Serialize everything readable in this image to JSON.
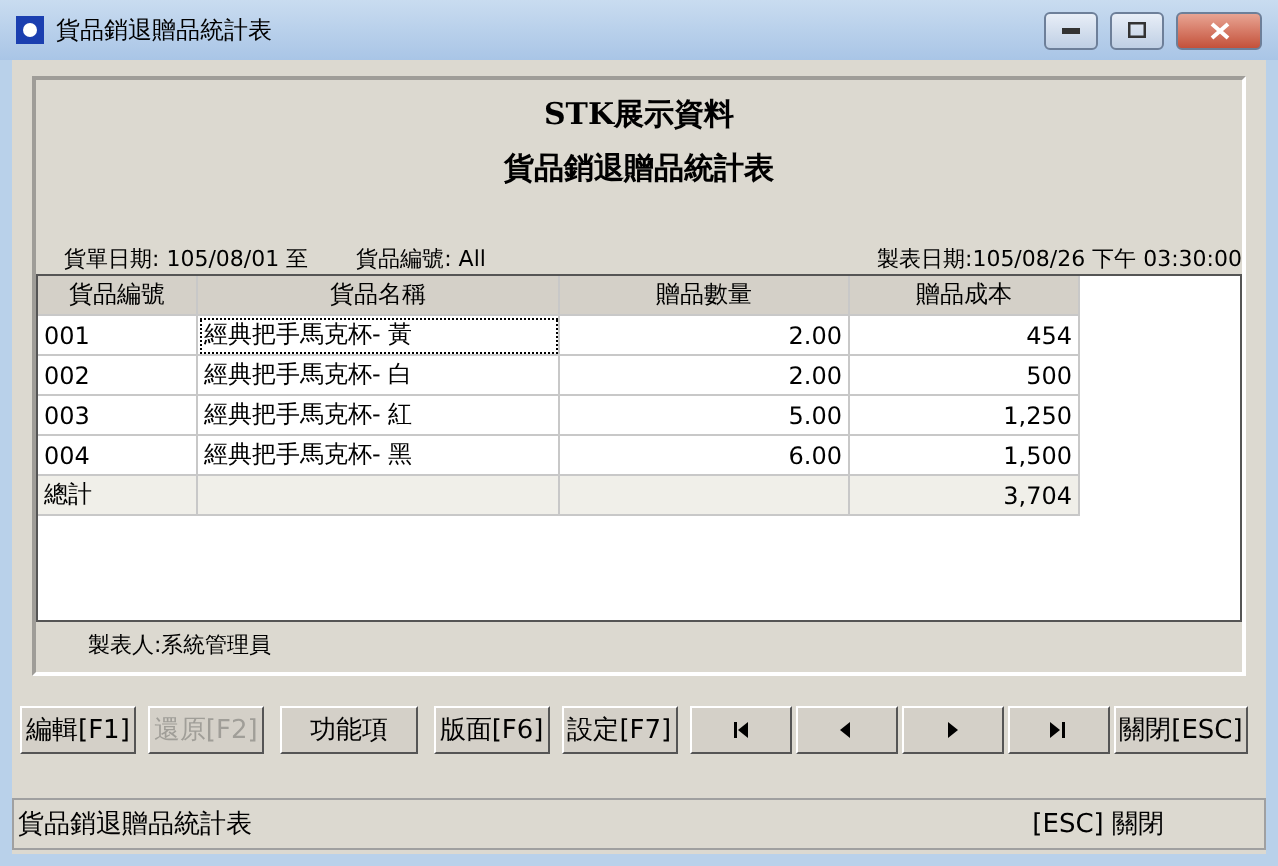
{
  "window": {
    "title": "貨品銷退贈品統計表"
  },
  "report": {
    "company": "STK展示資料",
    "title": "貨品銷退贈品統計表",
    "date_range": "貨單日期: 105/08/01 至",
    "product_filter": "貨品編號: All",
    "printed_at": "製表日期:105/08/26 下午 03:30:00",
    "maker": "製表人:系統管理員"
  },
  "table": {
    "columns": [
      "貨品編號",
      "貨品名稱",
      "贈品數量",
      "贈品成本"
    ],
    "rows": [
      {
        "code": "001",
        "name": "經典把手馬克杯- 黃",
        "qty": "2.00",
        "cost": "454",
        "focused": true
      },
      {
        "code": "002",
        "name": "經典把手馬克杯- 白",
        "qty": "2.00",
        "cost": "500",
        "focused": false
      },
      {
        "code": "003",
        "name": "經典把手馬克杯- 紅",
        "qty": "5.00",
        "cost": "1,250",
        "focused": false
      },
      {
        "code": "004",
        "name": "經典把手馬克杯- 黑",
        "qty": "6.00",
        "cost": "1,500",
        "focused": false
      }
    ],
    "total": {
      "label": "總計",
      "cost": "3,704"
    }
  },
  "buttons": [
    {
      "kind": "text",
      "label": "編輯[F1]",
      "disabled": false
    },
    {
      "kind": "text",
      "label": "還原[F2]",
      "disabled": true
    },
    {
      "kind": "text",
      "label": "功能項",
      "disabled": false
    },
    {
      "kind": "text",
      "label": "版面[F6]",
      "disabled": false
    },
    {
      "kind": "text",
      "label": "設定[F7]",
      "disabled": false
    },
    {
      "kind": "first",
      "disabled": false
    },
    {
      "kind": "prev",
      "disabled": false
    },
    {
      "kind": "next",
      "disabled": false
    },
    {
      "kind": "last",
      "disabled": false
    },
    {
      "kind": "text",
      "label": "關閉[ESC]",
      "disabled": false
    }
  ],
  "status_bar": {
    "left": "貨品銷退贈品統計表",
    "right": "[ESC] 關閉"
  }
}
